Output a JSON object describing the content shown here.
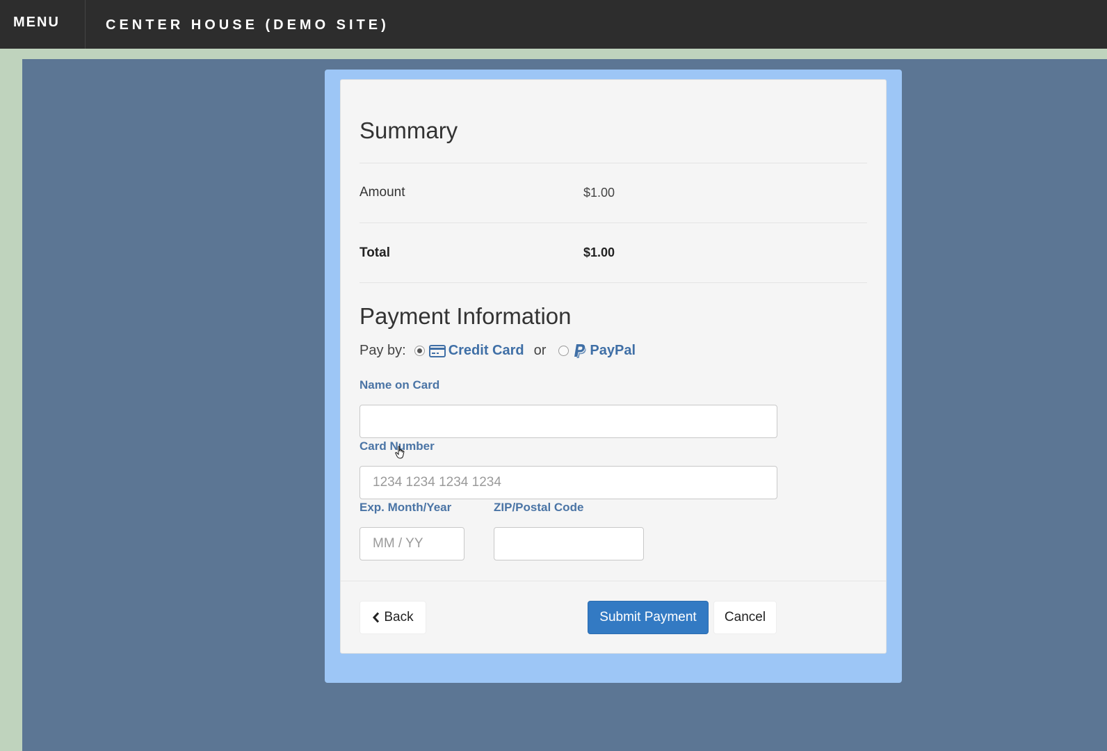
{
  "header": {
    "menu_label": "MENU",
    "site_title": "CENTER HOUSE (DEMO SITE)"
  },
  "summary": {
    "heading": "Summary",
    "amount_label": "Amount",
    "amount_value": "$1.00",
    "total_label": "Total",
    "total_value": "$1.00"
  },
  "payment": {
    "heading": "Payment Information",
    "pay_by_label": "Pay by:",
    "option_credit": "Credit Card",
    "or_text": "or",
    "option_paypal": "PayPal",
    "selected": "Credit Card",
    "name_label": "Name on Card",
    "name_value": "",
    "card_label": "Card Number",
    "card_placeholder": "1234 1234 1234 1234",
    "exp_label": "Exp. Month/Year",
    "exp_placeholder": "MM / YY",
    "zip_label": "ZIP/Postal Code",
    "zip_value": ""
  },
  "actions": {
    "back_label": "Back",
    "submit_label": "Submit Payment",
    "cancel_label": "Cancel"
  },
  "colors": {
    "topbar": "#2d2d2d",
    "page_bg": "#5c7694",
    "frame": "#9dc6f6",
    "accent": "#337ac3",
    "label": "#4a74a5"
  }
}
